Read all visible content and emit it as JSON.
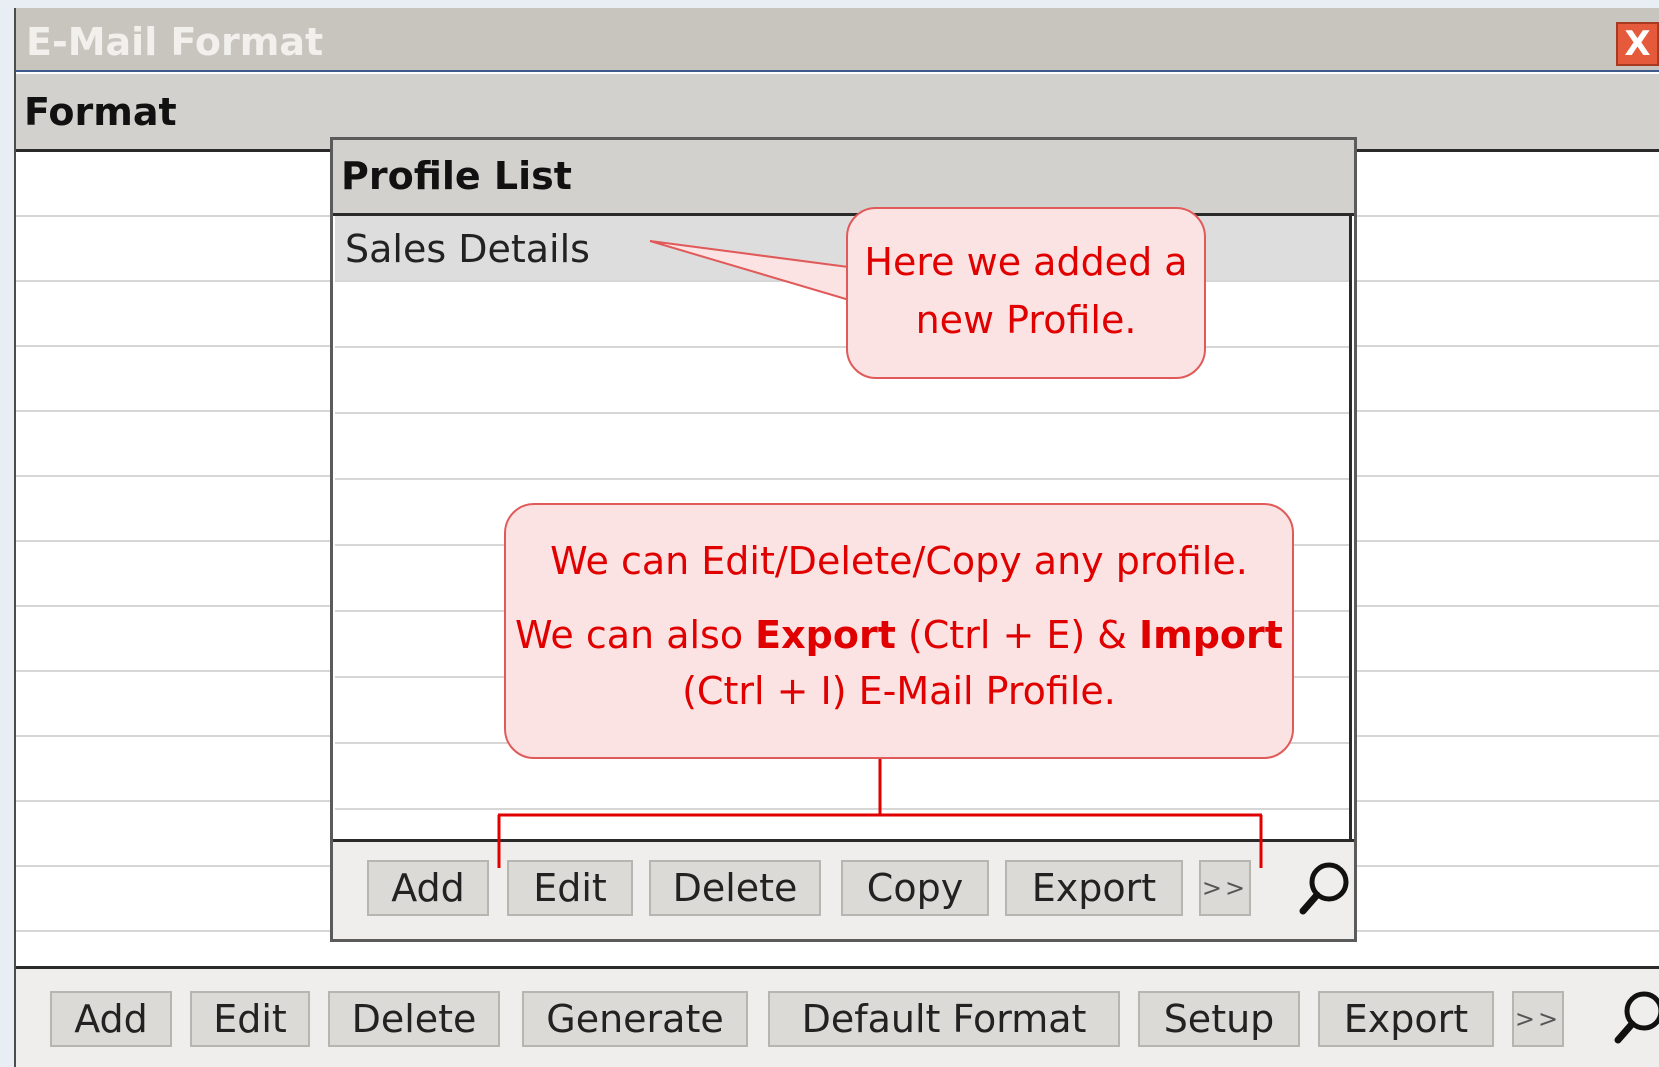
{
  "window": {
    "title": "E-Mail Format",
    "close_symbol": "X"
  },
  "format_panel": {
    "header": "Format"
  },
  "outer_toolbar": {
    "buttons": [
      "Add",
      "Edit",
      "Delete",
      "Generate",
      "Default Format",
      "Setup",
      "Export"
    ],
    "more_label": ">>",
    "search_icon": "magnifier-icon"
  },
  "profile_dialog": {
    "header": "Profile List",
    "rows": [
      "Sales Details"
    ],
    "buttons": [
      "Add",
      "Edit",
      "Delete",
      "Copy",
      "Export"
    ],
    "more_label": ">>",
    "search_icon": "magnifier-icon"
  },
  "callouts": {
    "new_profile": {
      "line1": "Here we added a",
      "line2": "new Profile."
    },
    "actions": {
      "line1": "We can Edit/Delete/Copy any profile.",
      "line2_pre": "We can also ",
      "line2_export": "Export",
      "line2_mid": " (Ctrl + E) & ",
      "line2_import": "Import",
      "line3": "(Ctrl + I) E-Mail Profile."
    }
  },
  "colors": {
    "callout_text": "#e00000",
    "callout_fill": "#fbe3e3",
    "callout_border": "#e05a5a",
    "title_bar": "#c8c5bf"
  }
}
